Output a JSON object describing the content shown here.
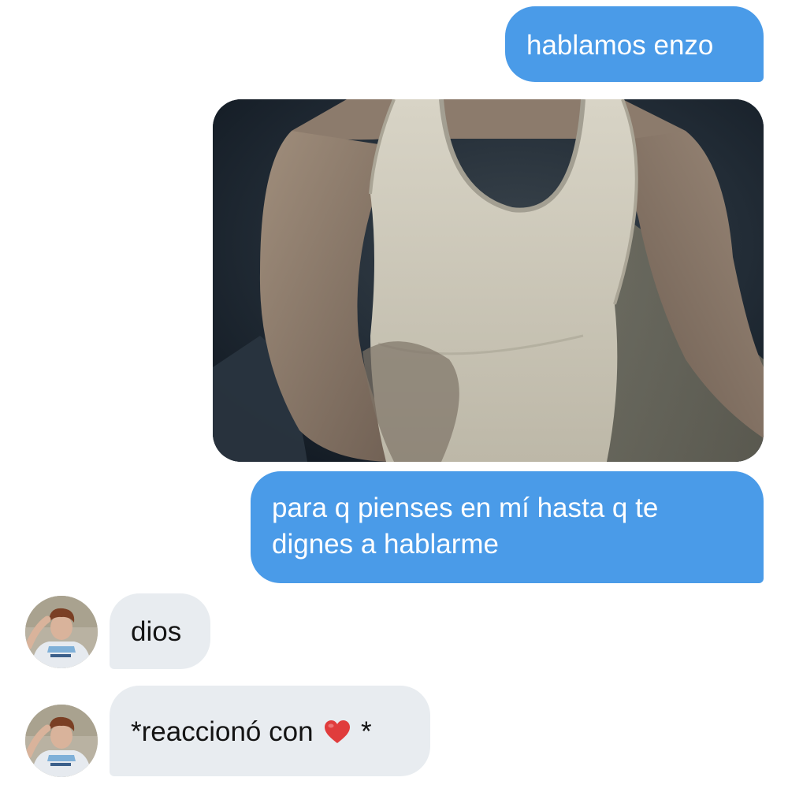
{
  "chat": {
    "messages": [
      {
        "direction": "outgoing",
        "type": "text",
        "text": "hablamos enzo"
      },
      {
        "direction": "outgoing",
        "type": "photo"
      },
      {
        "direction": "outgoing",
        "type": "text",
        "text": "para q pienses en mí hasta q te dignes a hablarme"
      },
      {
        "direction": "incoming",
        "type": "text",
        "text": "dios"
      },
      {
        "direction": "incoming",
        "type": "text",
        "text_before_icon": "*reaccionó con",
        "icon": "red-heart-icon",
        "text_after_icon": "*"
      }
    ]
  },
  "colors": {
    "outgoing_bubble": "#4a9be8",
    "incoming_bubble": "#e8ecf0",
    "background": "#ffffff",
    "heart": "#e03c3c"
  }
}
